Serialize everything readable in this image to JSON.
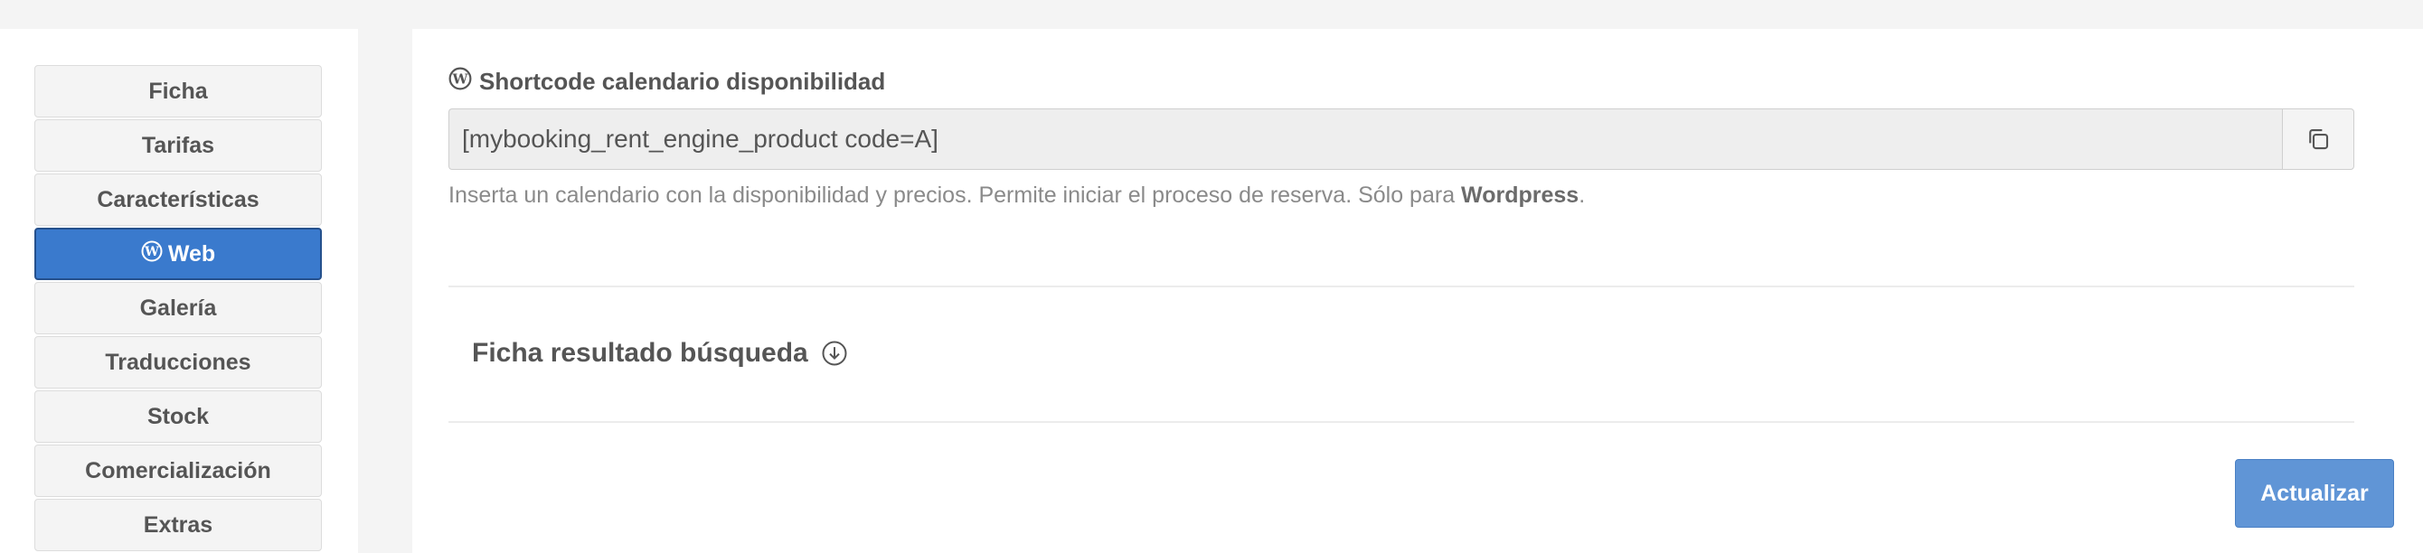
{
  "sidebar": {
    "items": [
      {
        "label": "Ficha",
        "active": false
      },
      {
        "label": "Tarifas",
        "active": false
      },
      {
        "label": "Características",
        "active": false
      },
      {
        "label": "Web",
        "active": true,
        "icon": "wordpress-icon"
      },
      {
        "label": "Galería",
        "active": false
      },
      {
        "label": "Traducciones",
        "active": false
      },
      {
        "label": "Stock",
        "active": false
      },
      {
        "label": "Comercialización",
        "active": false
      },
      {
        "label": "Extras",
        "active": false
      }
    ]
  },
  "main": {
    "shortcode": {
      "label": "Shortcode calendario disponibilidad",
      "label_icon": "wordpress-icon",
      "value": "[mybooking_rent_engine_product code=A]",
      "copy_icon": "copy-icon",
      "help_prefix": "Inserta un calendario con la disponibilidad y precios. Permite iniciar el proceso de reserva. Sólo para ",
      "help_strong": "Wordpress",
      "help_suffix": "."
    },
    "section": {
      "title": "Ficha resultado búsqueda",
      "toggle_icon": "circle-arrow-down-icon"
    },
    "update_button": "Actualizar"
  },
  "colors": {
    "active_nav_bg": "#3a7acd",
    "active_nav_border": "#25508c",
    "button_primary": "#6095d6",
    "page_bg": "#f4f4f4"
  }
}
